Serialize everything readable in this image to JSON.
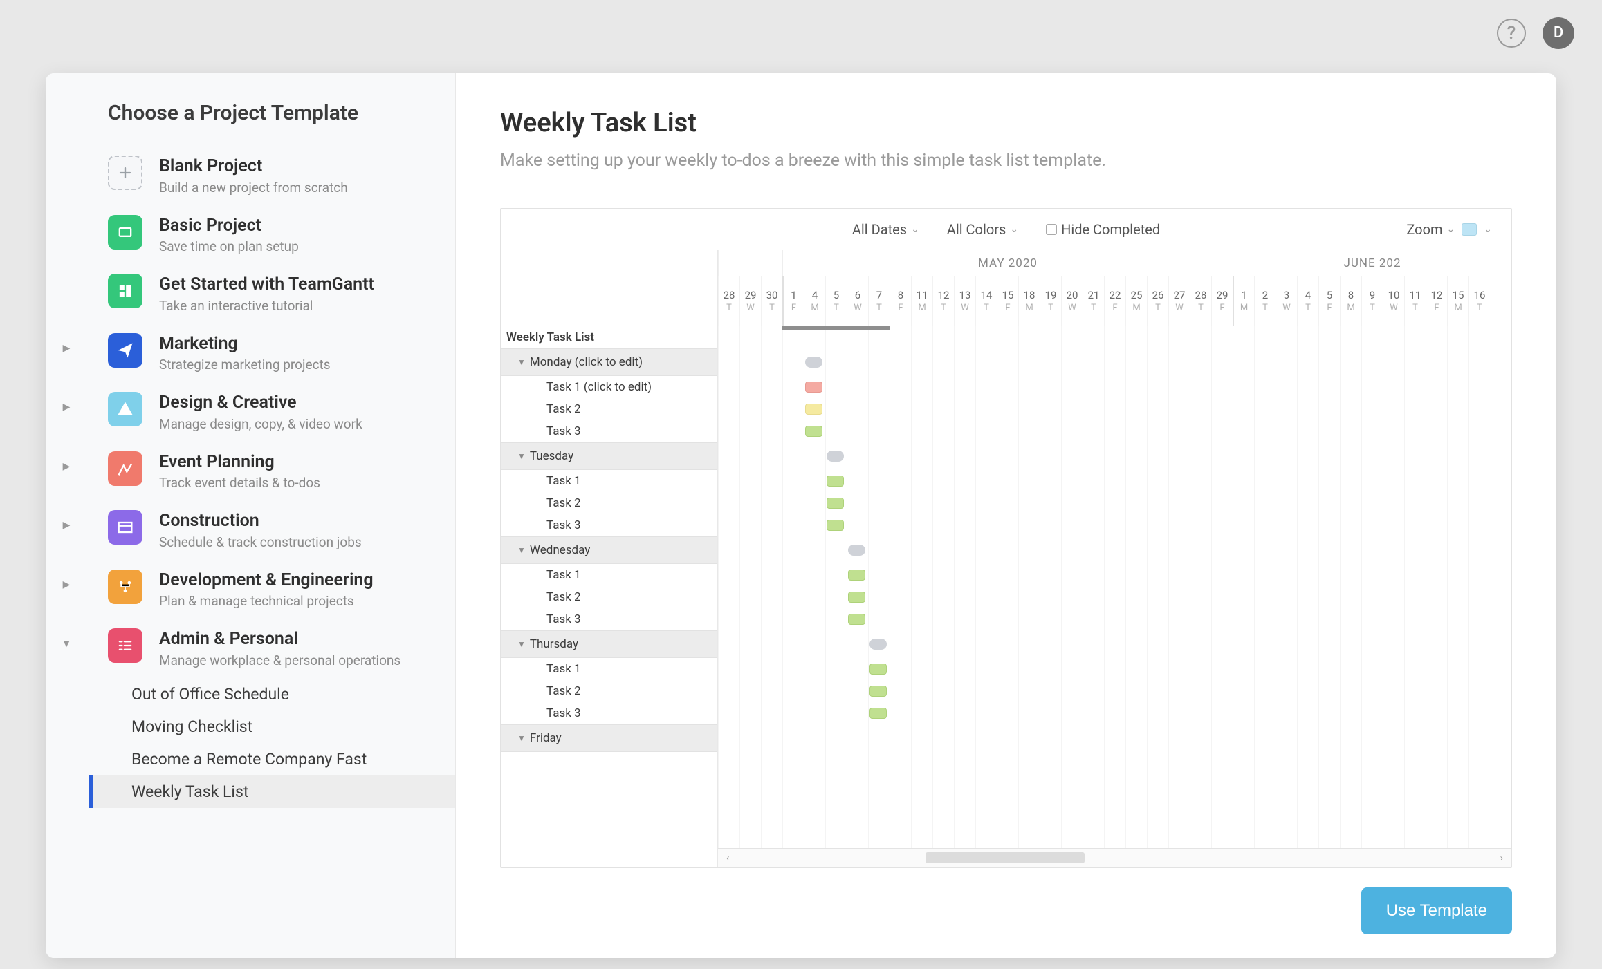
{
  "topbar": {
    "avatar_initial": "D"
  },
  "sidebar": {
    "title": "Choose a Project Template",
    "templates": [
      {
        "title": "Blank Project",
        "sub": "Build a new project from scratch",
        "expandable": false
      },
      {
        "title": "Basic Project",
        "sub": "Save time on plan setup",
        "expandable": false
      },
      {
        "title": "Get Started with TeamGantt",
        "sub": "Take an interactive tutorial",
        "expandable": false
      },
      {
        "title": "Marketing",
        "sub": "Strategize marketing projects",
        "expandable": true
      },
      {
        "title": "Design & Creative",
        "sub": "Manage design, copy, & video work",
        "expandable": true
      },
      {
        "title": "Event Planning",
        "sub": "Track event details & to-dos",
        "expandable": true
      },
      {
        "title": "Construction",
        "sub": "Schedule & track construction jobs",
        "expandable": true
      },
      {
        "title": "Development & Engineering",
        "sub": "Plan & manage technical projects",
        "expandable": true
      },
      {
        "title": "Admin & Personal",
        "sub": "Manage workplace & personal operations",
        "expandable": true,
        "expanded": true
      }
    ],
    "admin_subtemplates": [
      "Out of Office Schedule",
      "Moving Checklist",
      "Become a Remote Company Fast",
      "Weekly Task List"
    ],
    "selected_subtemplate": 3
  },
  "main": {
    "title": "Weekly Task List",
    "description": "Make setting up your weekly to-dos a breeze with this simple task list template.",
    "use_template_label": "Use Template"
  },
  "toolbar": {
    "all_dates": "All Dates",
    "all_colors": "All Colors",
    "hide_completed": "Hide Completed",
    "zoom": "Zoom"
  },
  "gantt": {
    "project_title": "Weekly Task List",
    "months": [
      {
        "label": "",
        "span": 3
      },
      {
        "label": "MAY 2020",
        "span": 21
      },
      {
        "label": "JUNE 202",
        "span": 13
      }
    ],
    "dates": [
      {
        "d": "28",
        "w": "T"
      },
      {
        "d": "29",
        "w": "W"
      },
      {
        "d": "30",
        "w": "T"
      },
      {
        "d": "1",
        "w": "F",
        "first": true
      },
      {
        "d": "4",
        "w": "M"
      },
      {
        "d": "5",
        "w": "T"
      },
      {
        "d": "6",
        "w": "W"
      },
      {
        "d": "7",
        "w": "T"
      },
      {
        "d": "8",
        "w": "F"
      },
      {
        "d": "11",
        "w": "M"
      },
      {
        "d": "12",
        "w": "T"
      },
      {
        "d": "13",
        "w": "W"
      },
      {
        "d": "14",
        "w": "T"
      },
      {
        "d": "15",
        "w": "F"
      },
      {
        "d": "18",
        "w": "M"
      },
      {
        "d": "19",
        "w": "T"
      },
      {
        "d": "20",
        "w": "W"
      },
      {
        "d": "21",
        "w": "T"
      },
      {
        "d": "22",
        "w": "F"
      },
      {
        "d": "25",
        "w": "M"
      },
      {
        "d": "26",
        "w": "T"
      },
      {
        "d": "27",
        "w": "W"
      },
      {
        "d": "28",
        "w": "T"
      },
      {
        "d": "29",
        "w": "F"
      },
      {
        "d": "1",
        "w": "M",
        "first": true
      },
      {
        "d": "2",
        "w": "T"
      },
      {
        "d": "3",
        "w": "W"
      },
      {
        "d": "4",
        "w": "T"
      },
      {
        "d": "5",
        "w": "F"
      },
      {
        "d": "8",
        "w": "M"
      },
      {
        "d": "9",
        "w": "T"
      },
      {
        "d": "10",
        "w": "W"
      },
      {
        "d": "11",
        "w": "T"
      },
      {
        "d": "12",
        "w": "F"
      },
      {
        "d": "15",
        "w": "M"
      },
      {
        "d": "16",
        "w": "T"
      }
    ],
    "groups": [
      {
        "name": "Monday (click to edit)",
        "summary": {
          "col": 4,
          "span": 1,
          "style": "gray pill"
        },
        "tasks": [
          {
            "label": "Task 1 (click to edit)",
            "col": 4,
            "span": 1,
            "style": "coral"
          },
          {
            "label": "Task 2",
            "col": 4,
            "span": 1,
            "style": "yellow"
          },
          {
            "label": "Task 3",
            "col": 4,
            "span": 1,
            "style": "green"
          }
        ]
      },
      {
        "name": "Tuesday",
        "summary": {
          "col": 5,
          "span": 1,
          "style": "gray pill"
        },
        "tasks": [
          {
            "label": "Task 1",
            "col": 5,
            "span": 1,
            "style": "green"
          },
          {
            "label": "Task 2",
            "col": 5,
            "span": 1,
            "style": "green"
          },
          {
            "label": "Task 3",
            "col": 5,
            "span": 1,
            "style": "green"
          }
        ]
      },
      {
        "name": "Wednesday",
        "summary": {
          "col": 6,
          "span": 1,
          "style": "gray pill"
        },
        "tasks": [
          {
            "label": "Task 1",
            "col": 6,
            "span": 1,
            "style": "green"
          },
          {
            "label": "Task 2",
            "col": 6,
            "span": 1,
            "style": "green"
          },
          {
            "label": "Task 3",
            "col": 6,
            "span": 1,
            "style": "green"
          }
        ]
      },
      {
        "name": "Thursday",
        "summary": {
          "col": 7,
          "span": 1,
          "style": "gray pill"
        },
        "tasks": [
          {
            "label": "Task 1",
            "col": 7,
            "span": 1,
            "style": "green"
          },
          {
            "label": "Task 2",
            "col": 7,
            "span": 1,
            "style": "green"
          },
          {
            "label": "Task 3",
            "col": 7,
            "span": 1,
            "style": "green"
          }
        ]
      },
      {
        "name": "Friday",
        "summary": null,
        "tasks": []
      }
    ]
  }
}
